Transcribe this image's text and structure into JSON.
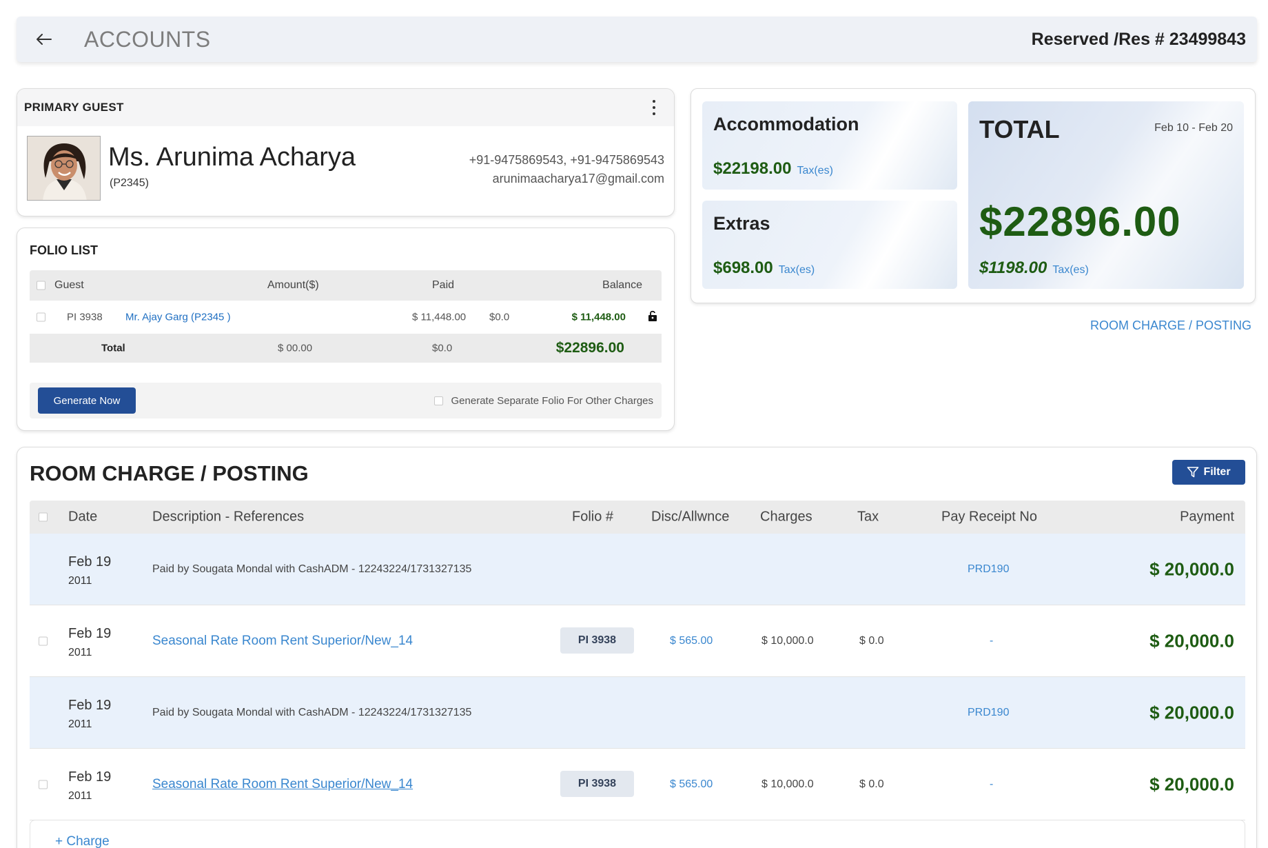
{
  "header": {
    "title": "ACCOUNTS",
    "reservation": "Reserved /Res # 23499843"
  },
  "primary_guest": {
    "section_title": "PRIMARY GUEST",
    "name": "Ms. Arunima Acharya",
    "code": "(P2345)",
    "phones": "+91-9475869543,  +91-9475869543",
    "email": "arunimaacharya17@gmail.com"
  },
  "folio_list": {
    "title": "FOLIO LIST",
    "columns": [
      "Guest",
      "Amount($)",
      "Paid",
      "Balance"
    ],
    "rows": [
      {
        "folio": "PI 3938",
        "guest": "Mr. Ajay Garg (P2345 )",
        "amount": "$ 11,448.00",
        "paid": "$0.0",
        "balance": "$ 11,448.00"
      }
    ],
    "total": {
      "label": "Total",
      "amount": "$ 00.00",
      "paid": "$0.0",
      "balance": "$22896.00"
    },
    "generate_button": "Generate Now",
    "separate_folio_label": "Generate Separate Folio For Other Charges"
  },
  "summary": {
    "accommodation": {
      "label": "Accommodation",
      "amount": "$22198.00",
      "tax": "Tax(es)"
    },
    "extras": {
      "label": "Extras",
      "amount": "$698.00",
      "tax": "Tax(es)"
    },
    "total": {
      "label": "TOTAL",
      "dates": "Feb 10 - Feb 20",
      "amount": "$22896.00",
      "tax_amount": "$1198.00",
      "tax": "Tax(es)"
    }
  },
  "room_charge_link": "ROOM CHARGE / POSTING",
  "room_charge": {
    "title": "ROOM CHARGE / POSTING",
    "filter_label": "Filter",
    "columns": [
      "Date",
      "Description - References",
      "Folio #",
      "Disc/Allwnce",
      "Charges",
      "Tax",
      "Pay Receipt No",
      "Payment"
    ],
    "rows": [
      {
        "date": "Feb 19",
        "year": "2011",
        "description": "Paid by Sougata Mondal with CashADM - 12243224/1731327135",
        "receipt": "PRD190",
        "payment": "$ 20,000.0"
      },
      {
        "date": "Feb 19",
        "year": "2011",
        "description": "Seasonal Rate Room Rent Superior/New_14",
        "folio": "PI 3938",
        "discount": "$ 565.00",
        "charges": "$ 10,000.0",
        "tax": "$ 0.0",
        "receipt": "-",
        "payment": "$ 20,000.0"
      },
      {
        "date": "Feb 19",
        "year": "2011",
        "description": "Paid by Sougata Mondal with CashADM - 12243224/1731327135",
        "receipt": "PRD190",
        "payment": "$ 20,000.0"
      },
      {
        "date": "Feb 19",
        "year": "2011",
        "description": "Seasonal Rate Room Rent Superior/New_14",
        "folio": "PI 3938",
        "discount": "$ 565.00",
        "charges": "$ 10,000.0",
        "tax": "$ 0.0",
        "receipt": "-",
        "payment": "$ 20,000.0"
      }
    ],
    "add_charge": "+  Charge"
  },
  "colors": {
    "accent": "#234e96",
    "link": "#3a87cf",
    "money": "#1e5c13"
  }
}
